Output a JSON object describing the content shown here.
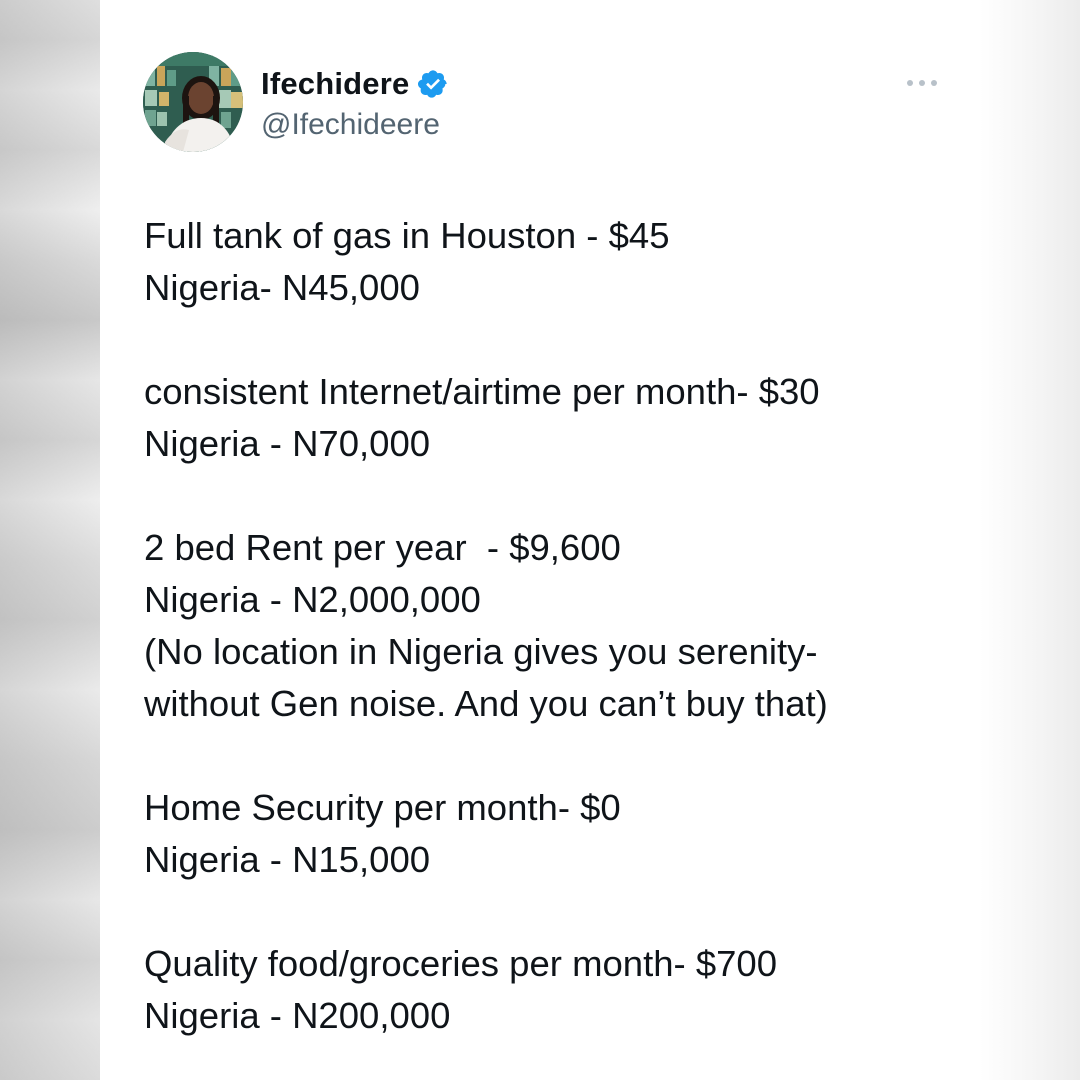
{
  "tweet": {
    "author": {
      "display_name": "Ifechidere",
      "handle": "@Ifechideere",
      "verified_icon": "verified-badge-icon",
      "avatar": "profile-photo"
    },
    "more_icon": "more-options-icon",
    "lines": [
      "Full tank of gas in Houston - $45",
      "Nigeria- N45,000",
      "",
      "consistent Internet/airtime per month- $30",
      "Nigeria - N70,000",
      "",
      "2 bed Rent per year  - $9,600",
      "Nigeria - N2,000,000",
      "(No location in Nigeria gives you serenity-",
      "without Gen noise. And you can’t buy that)",
      "",
      "Home Security per month- $0",
      "Nigeria - N15,000",
      "",
      "Quality food/groceries per month- $700",
      "Nigeria - N200,000"
    ]
  },
  "colors": {
    "text_primary": "#0f1419",
    "text_secondary": "#536471",
    "verified_blue": "#1d9bf0"
  }
}
